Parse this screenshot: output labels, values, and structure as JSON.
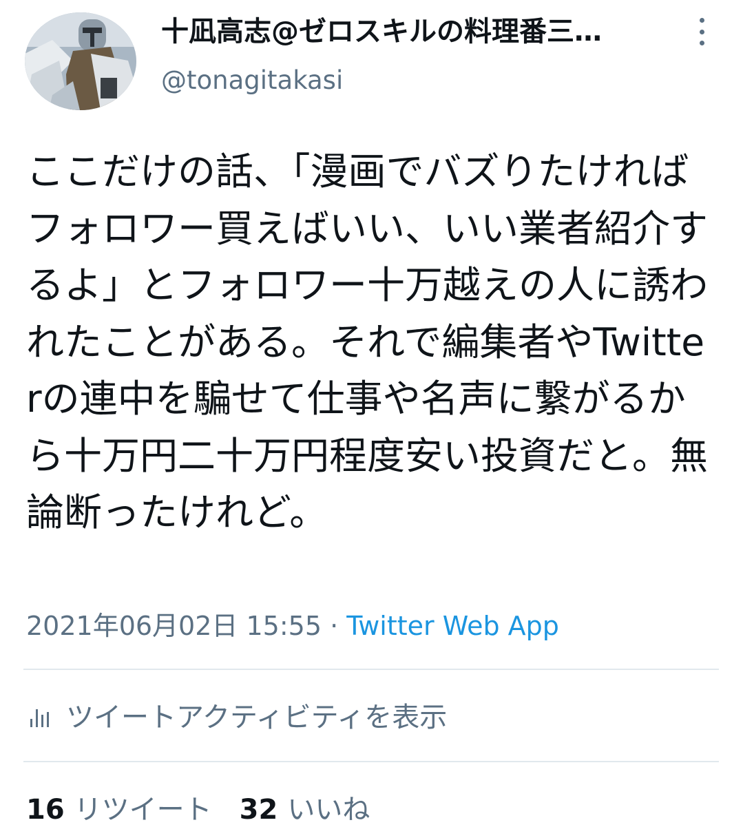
{
  "author": {
    "display_name": "十凪高志@ゼロスキルの料理番三…",
    "handle": "@tonagitakasi"
  },
  "tweet": {
    "text": "ここだけの話、「漫画でバズりたければフォロワー買えばいい、いい業者紹介するよ」とフォロワー十万越えの人に誘われたことがある。それで編集者やTwitterの連中を騙せて仕事や名声に繋がるから十万円二十万円程度安い投資だと。無論断ったけれど。",
    "timestamp": "2021年06月02日 15:55",
    "separator": "·",
    "source_app": "Twitter Web App"
  },
  "activity": {
    "label": "ツイートアクティビティを表示"
  },
  "stats": {
    "retweets_count": "16",
    "retweets_label": "リツイート",
    "likes_count": "32",
    "likes_label": "いいね"
  },
  "icons": {
    "more": "more-vertical-icon",
    "activity": "bar-chart-icon"
  },
  "colors": {
    "text": "#0f1419",
    "secondary": "#5b7083",
    "link": "#1b95e0",
    "divider": "#e1e8ed"
  }
}
